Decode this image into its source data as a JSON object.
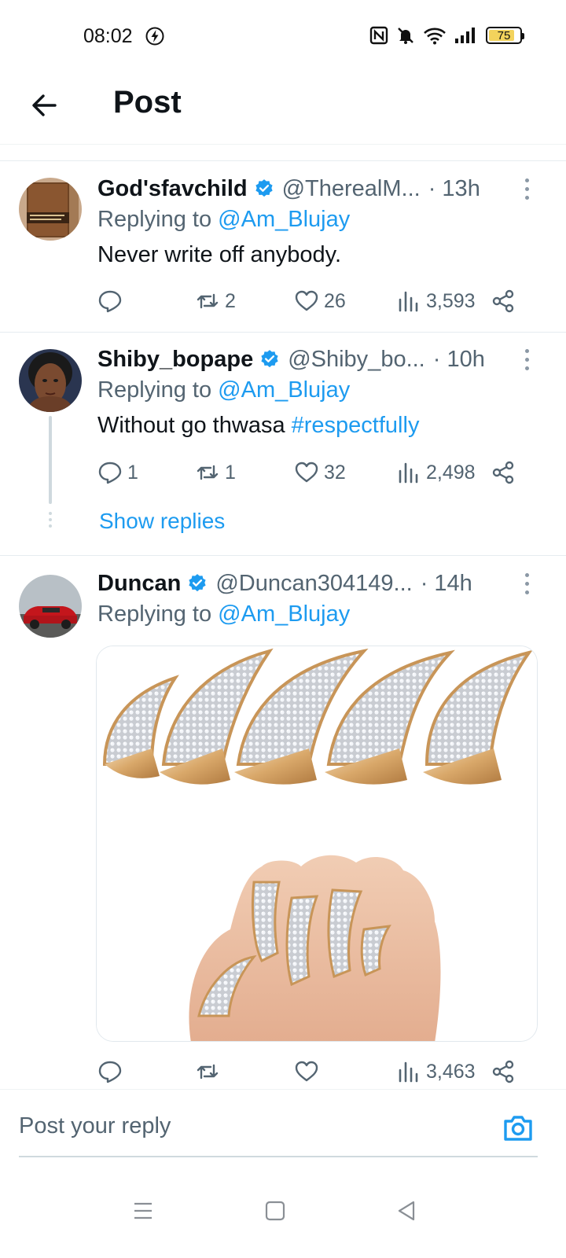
{
  "status_bar": {
    "time": "08:02",
    "battery": "75",
    "icons": [
      "charging-bolt-icon",
      "nfc-icon",
      "mute-icon",
      "wifi-icon",
      "signal-icon",
      "battery-icon"
    ]
  },
  "header": {
    "title": "Post",
    "back_icon": "back-arrow-icon"
  },
  "colors": {
    "link": "#1d9bf0",
    "secondary_text": "#536471",
    "verified": "#1d9bf0",
    "battery_fill": "#f3d35c"
  },
  "tweets": [
    {
      "name": "God'sfavchild",
      "handle": "@TherealM...",
      "time": "· 13h",
      "replying_prefix": "Replying to",
      "replying_to": "@Am_Blujay",
      "text": "Never write off anybody.",
      "replies": "",
      "retweets": "2",
      "likes": "26",
      "views": "3,593"
    },
    {
      "name": "Shiby_bopape",
      "handle": "@Shiby_bo...",
      "time": "· 10h",
      "replying_prefix": "Replying to",
      "replying_to": "@Am_Blujay",
      "text": "Without go thwasa ",
      "hashtag": "#respectfully",
      "replies": "1",
      "retweets": "1",
      "likes": "32",
      "views": "2,498",
      "show_replies": "Show replies"
    },
    {
      "name": "Duncan",
      "handle": "@Duncan304149...",
      "time": "· 14h",
      "replying_prefix": "Replying to",
      "replying_to": "@Am_Blujay",
      "media": "image of jeweled gold claw finger rings",
      "replies": "",
      "retweets": "",
      "likes": "",
      "views": "3,463"
    }
  ],
  "reply_bar": {
    "placeholder": "Post your reply",
    "camera_icon": "camera-icon"
  },
  "nav_bar": {
    "icons": [
      "menu-icon",
      "home-square-icon",
      "back-triangle-icon"
    ]
  }
}
